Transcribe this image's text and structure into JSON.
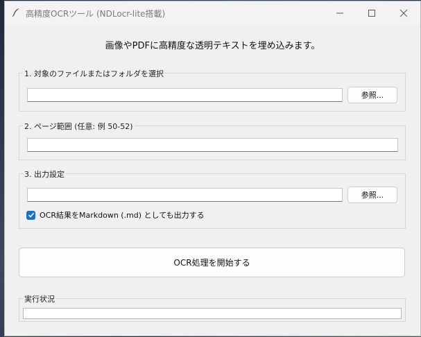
{
  "window": {
    "title": "高精度OCRツール (NDLocr-lite搭載)",
    "minimize_icon": "minimize-icon",
    "maximize_icon": "maximize-icon",
    "close_icon": "close-icon"
  },
  "headline": "画像やPDFに高精度な透明テキストを埋め込みます。",
  "section1": {
    "label": "1. 対象のファイルまたはフォルダを選択",
    "path_value": "",
    "browse_label": "参照..."
  },
  "section2": {
    "label": "2. ページ範囲 (任意: 例 50-52)",
    "range_value": ""
  },
  "section3": {
    "label": "3. 出力設定",
    "output_value": "",
    "browse_label": "参照...",
    "markdown_checked": true,
    "markdown_label": "OCR結果をMarkdown (.md) としても出力する"
  },
  "start_button": "OCR処理を開始する",
  "status": {
    "label": "実行状況",
    "value": ""
  },
  "colors": {
    "accent": "#1a6fc9",
    "window_bg": "#f0f0f0"
  }
}
